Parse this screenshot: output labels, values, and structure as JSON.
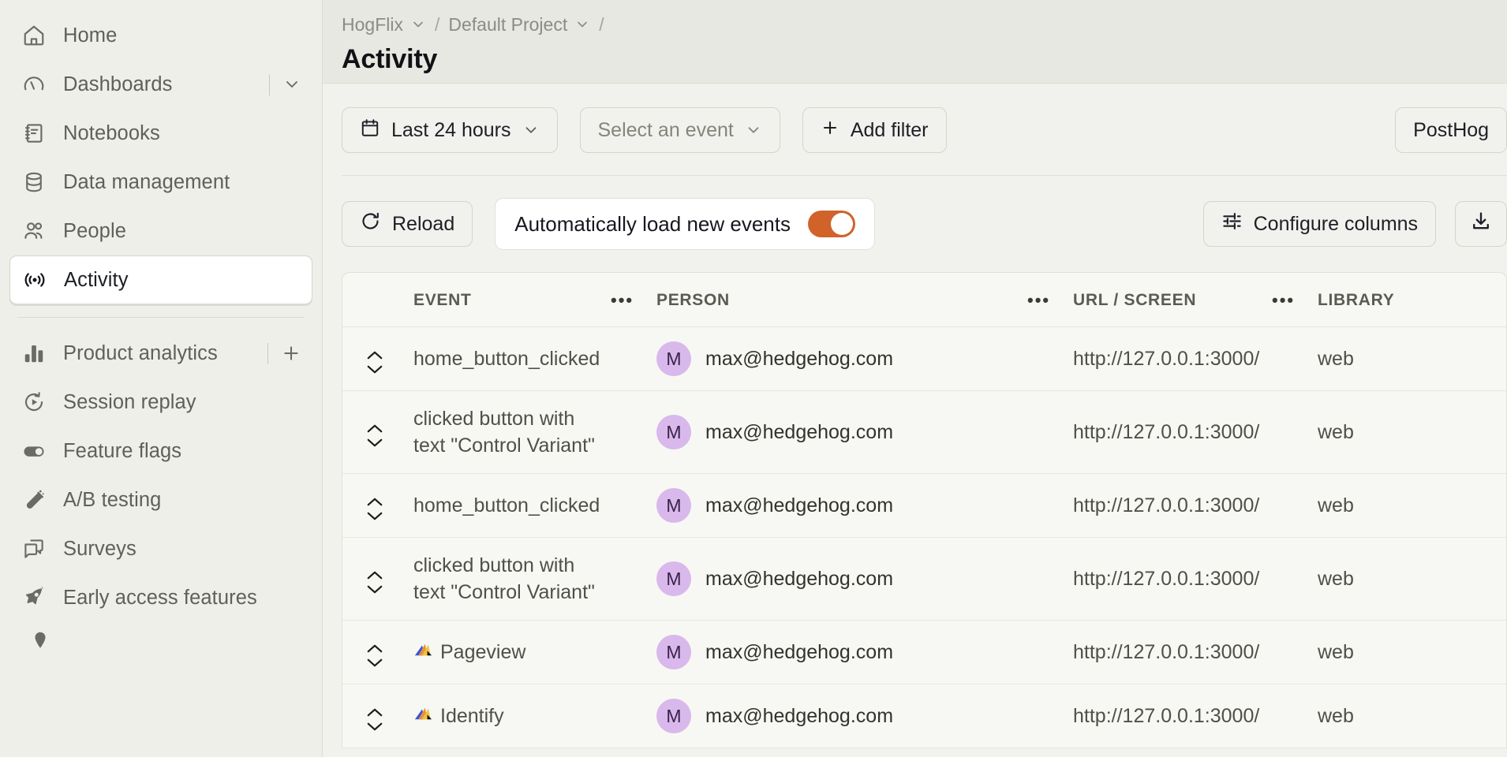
{
  "sidebar": {
    "primary_items": [
      {
        "label": "Home",
        "icon": "home-icon"
      },
      {
        "label": "Dashboards",
        "icon": "gauge-icon",
        "has_chevron": true
      },
      {
        "label": "Notebooks",
        "icon": "notebook-icon"
      },
      {
        "label": "Data management",
        "icon": "database-icon"
      },
      {
        "label": "People",
        "icon": "people-icon"
      },
      {
        "label": "Activity",
        "icon": "broadcast-icon",
        "active": true
      }
    ],
    "secondary_items": [
      {
        "label": "Product analytics",
        "icon": "bar-chart-icon",
        "has_plus": true
      },
      {
        "label": "Session replay",
        "icon": "replay-icon"
      },
      {
        "label": "Feature flags",
        "icon": "toggle-icon"
      },
      {
        "label": "A/B testing",
        "icon": "flask-icon"
      },
      {
        "label": "Surveys",
        "icon": "chat-icon"
      },
      {
        "label": "Early access features",
        "icon": "rocket-icon"
      }
    ]
  },
  "header": {
    "breadcrumb": [
      {
        "label": "HogFlix",
        "chevron": true
      },
      {
        "label": "Default Project",
        "chevron": true
      }
    ],
    "separator": "/",
    "title": "Activity"
  },
  "filters": {
    "date_range": "Last 24 hours",
    "event_select_placeholder": "Select an event",
    "add_filter": "Add filter",
    "right_button": "PostHog"
  },
  "actions": {
    "reload": "Reload",
    "auto_load_label": "Automatically load new events",
    "auto_load_enabled": true,
    "configure_columns": "Configure columns",
    "export_icon": "download-icon",
    "toggle_color": "#d1622a"
  },
  "table": {
    "columns": [
      "EVENT",
      "PERSON",
      "URL / SCREEN",
      "LIBRARY"
    ],
    "menu_glyph": "•••",
    "rows": [
      {
        "event": "home_button_clicked",
        "has_glyph": false,
        "avatar": "M",
        "person": "max@hedgehog.com",
        "url": "http://127.0.0.1:3000/",
        "library": "web"
      },
      {
        "event": "clicked button with text \"Control Variant\"",
        "has_glyph": false,
        "avatar": "M",
        "person": "max@hedgehog.com",
        "url": "http://127.0.0.1:3000/",
        "library": "web"
      },
      {
        "event": "home_button_clicked",
        "has_glyph": false,
        "avatar": "M",
        "person": "max@hedgehog.com",
        "url": "http://127.0.0.1:3000/",
        "library": "web"
      },
      {
        "event": "clicked button with text \"Control Variant\"",
        "has_glyph": false,
        "avatar": "M",
        "person": "max@hedgehog.com",
        "url": "http://127.0.0.1:3000/",
        "library": "web"
      },
      {
        "event": "Pageview",
        "has_glyph": true,
        "avatar": "M",
        "person": "max@hedgehog.com",
        "url": "http://127.0.0.1:3000/",
        "library": "web"
      },
      {
        "event": "Identify",
        "has_glyph": true,
        "avatar": "M",
        "person": "max@hedgehog.com",
        "url": "http://127.0.0.1:3000/",
        "library": "web"
      }
    ]
  }
}
